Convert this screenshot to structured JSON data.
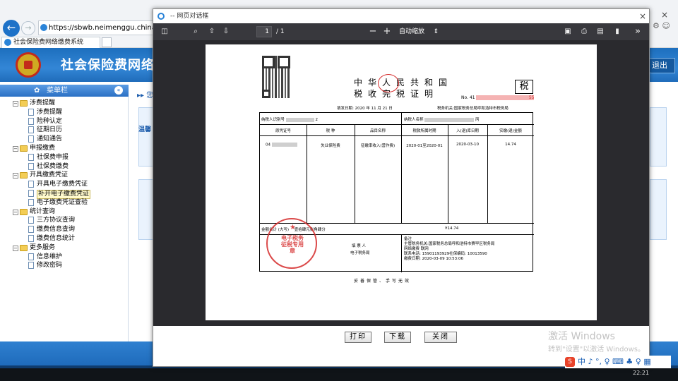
{
  "browser": {
    "url": "https://sbwb.neimenggu.chinatax.gov",
    "tab_title": "社会保险费网络缴费系统",
    "new_tab": "",
    "close": "×",
    "tools": "⚙ ☺"
  },
  "site": {
    "title": "社会保险费网络缴",
    "logout": "退出",
    "breadcrumb": "▸▸ 您",
    "warn_text": "温馨"
  },
  "sidebar": {
    "menubar_label": "菜单栏",
    "items": [
      {
        "label": "涉费提醒",
        "type": "folder",
        "level": 0
      },
      {
        "label": "涉费提醒",
        "type": "doc",
        "level": 1
      },
      {
        "label": "险种认定",
        "type": "doc",
        "level": 1
      },
      {
        "label": "征期日历",
        "type": "doc",
        "level": 1
      },
      {
        "label": "通知通告",
        "type": "doc",
        "level": 1
      },
      {
        "label": "申报缴费",
        "type": "folder",
        "level": 0
      },
      {
        "label": "社保费申报",
        "type": "doc",
        "level": 1
      },
      {
        "label": "社保费缴费",
        "type": "doc",
        "level": 1
      },
      {
        "label": "开具缴费凭证",
        "type": "folder",
        "level": 0
      },
      {
        "label": "开具电子缴费凭证",
        "type": "doc",
        "level": 1
      },
      {
        "label": "补开电子缴费凭证",
        "type": "doc",
        "level": 1,
        "selected": true
      },
      {
        "label": "电子缴费凭证查验",
        "type": "doc",
        "level": 1
      },
      {
        "label": "统计查询",
        "type": "folder",
        "level": 0
      },
      {
        "label": "三方协议查询",
        "type": "doc",
        "level": 1
      },
      {
        "label": "缴费信息查询",
        "type": "doc",
        "level": 1
      },
      {
        "label": "缴费信息统计",
        "type": "doc",
        "level": 1
      },
      {
        "label": "更多服务",
        "type": "folder",
        "level": 0
      },
      {
        "label": "信息维护",
        "type": "doc",
        "level": 1
      },
      {
        "label": "修改密码",
        "type": "doc",
        "level": 1
      }
    ]
  },
  "dialog": {
    "title": "-- 网页对话框",
    "close": "×",
    "pdf": {
      "page_current": "1",
      "page_total": "/ 1",
      "zoom_minus": "−",
      "zoom_plus": "+",
      "zoom_label": "自动缩放",
      "more": "»"
    },
    "buttons": {
      "print": "打印",
      "download": "下载",
      "close": "关闭"
    }
  },
  "certificate": {
    "title_line1": "中华人民共和国",
    "title_line2": "税收完税证明",
    "tax_char": "税",
    "no_label": "No.",
    "no_prefix": "41",
    "no_suffix": "55",
    "fill_date": "填发日期: 2020 年  11 月 21 日",
    "tax_office": "税务机关:国家税务总局呼和浩特市税务局",
    "taxpayer_id_label": "纳税人识别号",
    "taxpayer_id_suffix": "2",
    "taxpayer_name_label": "纳税人名称",
    "taxpayer_name_suffix": "丙",
    "headers": [
      "原凭证号",
      "税  种",
      "品目名称",
      "税款所属时期",
      "入(退)库日期",
      "实缴(退)金额"
    ],
    "row": {
      "voucher": "04",
      "tax_type": "失业保险费",
      "item": "征缴率收入(营作费)",
      "period": "2020-01至2020-01",
      "date": "2020-03-10",
      "amount": "14.74"
    },
    "total_label": "金额合计 (大写)",
    "total_words": "壹拾肆元柒角肆分",
    "total_value": "¥14.74",
    "filler_label": "填 票 人",
    "filler_value": "电子税务局",
    "remarks": [
      "备注",
      "主管税务机关:国家税务总局呼和浩特市赛罕区税务局",
      "网络缴费 联网",
      "联系电话: 15901193929社保编码: 10013590",
      "缴费日期: 2020-03-09 10:53:06"
    ],
    "seal_text": "电子税务征税专用章",
    "footer": "妥善保管、手写无效"
  },
  "watermark": {
    "line1": "激活 Windows",
    "line2": "转到\"设置\"以激活 Windows。"
  },
  "ime": {
    "logo": "S",
    "text": "中 ♪ °, ♀ ⌨ ♣ ♀ ▦"
  },
  "taskbar": {
    "clock": "22:21"
  }
}
